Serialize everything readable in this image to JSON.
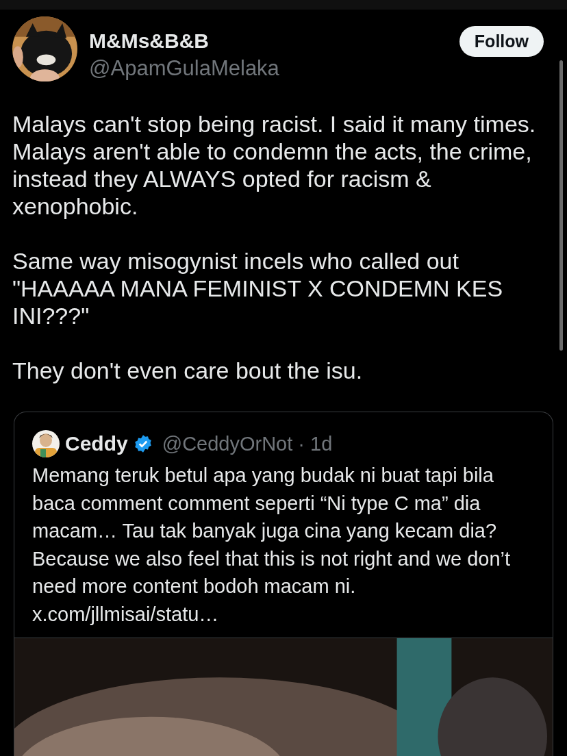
{
  "author": {
    "name": "M&Ms&B&B",
    "handle": "@ApamGulaMelaka"
  },
  "follow_button": "Follow",
  "paragraphs": [
    "Malays can't stop being racist. I said it many times. Malays aren't able to condemn the acts, the crime, instead they ALWAYS opted for racism & xenophobic.",
    "Same way misogynist incels who called out \"HAAAAA MANA FEMINIST X CONDEMN KES INI???\"",
    "They don't even care bout the isu."
  ],
  "quoted": {
    "name": "Ceddy",
    "verified": true,
    "meta": "@CeddyOrNot · 1d",
    "text": "Memang teruk betul apa yang budak ni buat tapi bila baca comment comment seperti “Ni type C ma” dia macam… Tau tak banyak juga cina yang kecam dia? Because we also feel that this is not right and we don’t need more content bodoh macam ni. x.com/jllmisai/statu…"
  }
}
